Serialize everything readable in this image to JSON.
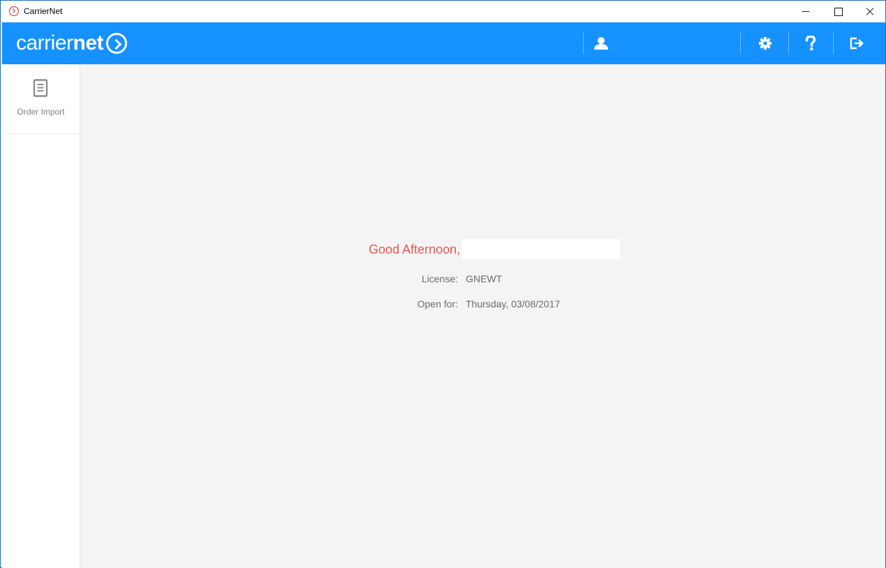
{
  "window": {
    "title": "CarrierNet"
  },
  "header": {
    "logo_light": "carrier",
    "logo_bold": "net",
    "icons": [
      "user-icon",
      "gear-icon",
      "help-icon",
      "logout-icon"
    ]
  },
  "sidebar": {
    "items": [
      {
        "label": "Order Import",
        "icon": "document-icon"
      }
    ]
  },
  "main": {
    "greeting": "Good Afternoon,",
    "license_label": "License:",
    "license_value": "GNEWT",
    "open_for_label": "Open for:",
    "open_for_value": "Thursday, 03/08/2017"
  },
  "colors": {
    "header_bg": "#1592ff",
    "greeting": "#f0554f",
    "main_bg": "#f4f4f4"
  }
}
